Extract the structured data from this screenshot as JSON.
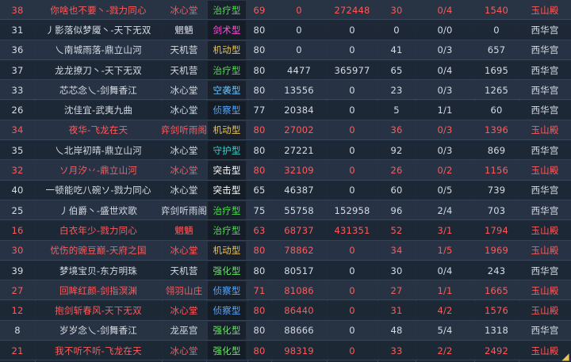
{
  "colors": {
    "enemy_text": "#ff5a5a",
    "ally_text": "#d6dbe4",
    "type_heal": "#4be24b",
    "type_sword": "#ff4fd8",
    "type_mobile": "#e8c25a",
    "type_air": "#6fc7ff",
    "type_scout": "#5aa8ff",
    "type_guard": "#3fd0c8",
    "type_assault": "#ffffff",
    "type_strong": "#6fe06f"
  },
  "rows": [
    {
      "lvl_req": "38",
      "name": "你啥也不要丶-戮力同心",
      "sect": "冰心堂",
      "type": "治疗型",
      "type_color": "#4be24b",
      "level": "69",
      "damage": "0",
      "heal": "272448",
      "score": "30",
      "kd": "0/4",
      "points": "1540",
      "server": "玉山殿",
      "enemy": true
    },
    {
      "lvl_req": "31",
      "name": "丿影落似梦魇丶-天下无双",
      "sect": "魍魉",
      "type": "剑术型",
      "type_color": "#ff4fd8",
      "level": "80",
      "damage": "0",
      "heal": "0",
      "score": "0",
      "kd": "0/0",
      "points": "0",
      "server": "西华宫",
      "enemy": false
    },
    {
      "lvl_req": "36",
      "name": "乀南城雨落-鼎立山河",
      "sect": "天机营",
      "type": "机动型",
      "type_color": "#e8c25a",
      "level": "80",
      "damage": "0",
      "heal": "0",
      "score": "41",
      "kd": "0/3",
      "points": "657",
      "server": "西华宫",
      "enemy": false
    },
    {
      "lvl_req": "37",
      "name": "龙龙撩刀丶-天下无双",
      "sect": "天机营",
      "type": "治疗型",
      "type_color": "#4be24b",
      "level": "80",
      "damage": "4477",
      "heal": "365977",
      "score": "65",
      "kd": "0/4",
      "points": "1695",
      "server": "西华宫",
      "enemy": false
    },
    {
      "lvl_req": "33",
      "name": "芯芯念乀-剑舞香江",
      "sect": "冰心堂",
      "type": "空袭型",
      "type_color": "#6fc7ff",
      "level": "80",
      "damage": "13556",
      "heal": "0",
      "score": "23",
      "kd": "0/3",
      "points": "1265",
      "server": "西华宫",
      "enemy": false
    },
    {
      "lvl_req": "26",
      "name": "沈佳宜-武夷九曲",
      "sect": "冰心堂",
      "type": "侦察型",
      "type_color": "#5aa8ff",
      "level": "77",
      "damage": "20384",
      "heal": "0",
      "score": "5",
      "kd": "1/1",
      "points": "60",
      "server": "西华宫",
      "enemy": false
    },
    {
      "lvl_req": "34",
      "name": "夜华-飞龙在天",
      "sect": "弈剑听雨阁",
      "type": "机动型",
      "type_color": "#e8c25a",
      "level": "80",
      "damage": "27002",
      "heal": "0",
      "score": "36",
      "kd": "0/3",
      "points": "1396",
      "server": "玉山殿",
      "enemy": true
    },
    {
      "lvl_req": "35",
      "name": "乀北岸初晴-鼎立山河",
      "sect": "冰心堂",
      "type": "守护型",
      "type_color": "#3fd0c8",
      "level": "80",
      "damage": "27221",
      "heal": "0",
      "score": "92",
      "kd": "0/3",
      "points": "869",
      "server": "西华宫",
      "enemy": false
    },
    {
      "lvl_req": "32",
      "name": "ソ月汐丷-鼎立山河",
      "sect": "冰心堂",
      "type": "突击型",
      "type_color": "#ffffff",
      "level": "80",
      "damage": "32109",
      "heal": "0",
      "score": "26",
      "kd": "0/2",
      "points": "1156",
      "server": "玉山殿",
      "enemy": true
    },
    {
      "lvl_req": "40",
      "name": "一顿能吃八碗ソ-戮力同心",
      "sect": "冰心堂",
      "type": "突击型",
      "type_color": "#ffffff",
      "level": "65",
      "damage": "46387",
      "heal": "0",
      "score": "60",
      "kd": "0/5",
      "points": "739",
      "server": "西华宫",
      "enemy": false
    },
    {
      "lvl_req": "25",
      "name": "丿伯爵丶-盛世欢歌",
      "sect": "弈剑听雨阁",
      "type": "治疗型",
      "type_color": "#4be24b",
      "level": "75",
      "damage": "55758",
      "heal": "152958",
      "score": "96",
      "kd": "2/4",
      "points": "703",
      "server": "西华宫",
      "enemy": false
    },
    {
      "lvl_req": "16",
      "name": "白衣年少-戮力同心",
      "sect": "魍魉",
      "type": "治疗型",
      "type_color": "#4be24b",
      "level": "63",
      "damage": "68737",
      "heal": "431351",
      "score": "52",
      "kd": "3/1",
      "points": "1794",
      "server": "玉山殿",
      "enemy": true
    },
    {
      "lvl_req": "30",
      "name": "忧伤的豌豆巅-天府之国",
      "sect": "冰心堂",
      "type": "机动型",
      "type_color": "#e8c25a",
      "level": "80",
      "damage": "78862",
      "heal": "0",
      "score": "34",
      "kd": "1/5",
      "points": "1969",
      "server": "玉山殿",
      "enemy": true
    },
    {
      "lvl_req": "39",
      "name": "梦境宝贝-东方明珠",
      "sect": "天机营",
      "type": "强化型",
      "type_color": "#6fe06f",
      "level": "80",
      "damage": "80517",
      "heal": "0",
      "score": "30",
      "kd": "0/4",
      "points": "243",
      "server": "西华宫",
      "enemy": false
    },
    {
      "lvl_req": "27",
      "name": "回眸红颜-剑指溟渊",
      "sect": "翎羽山庄",
      "type": "侦察型",
      "type_color": "#5aa8ff",
      "level": "71",
      "damage": "81086",
      "heal": "0",
      "score": "27",
      "kd": "1/1",
      "points": "1665",
      "server": "玉山殿",
      "enemy": true
    },
    {
      "lvl_req": "12",
      "name": "抱剑斩春风-天下无双",
      "sect": "冰心堂",
      "type": "侦察型",
      "type_color": "#5aa8ff",
      "level": "80",
      "damage": "86440",
      "heal": "0",
      "score": "31",
      "kd": "4/2",
      "points": "1576",
      "server": "玉山殿",
      "enemy": true
    },
    {
      "lvl_req": "8",
      "name": "岁岁念乀-剑舞香江",
      "sect": "龙巫宫",
      "type": "强化型",
      "type_color": "#6fe06f",
      "level": "80",
      "damage": "88666",
      "heal": "0",
      "score": "48",
      "kd": "5/4",
      "points": "1318",
      "server": "西华宫",
      "enemy": false
    },
    {
      "lvl_req": "21",
      "name": "我不听不听-飞龙在天",
      "sect": "冰心堂",
      "type": "强化型",
      "type_color": "#6fe06f",
      "level": "80",
      "damage": "98319",
      "heal": "0",
      "score": "33",
      "kd": "2/2",
      "points": "2492",
      "server": "玉山殿",
      "enemy": true
    }
  ]
}
